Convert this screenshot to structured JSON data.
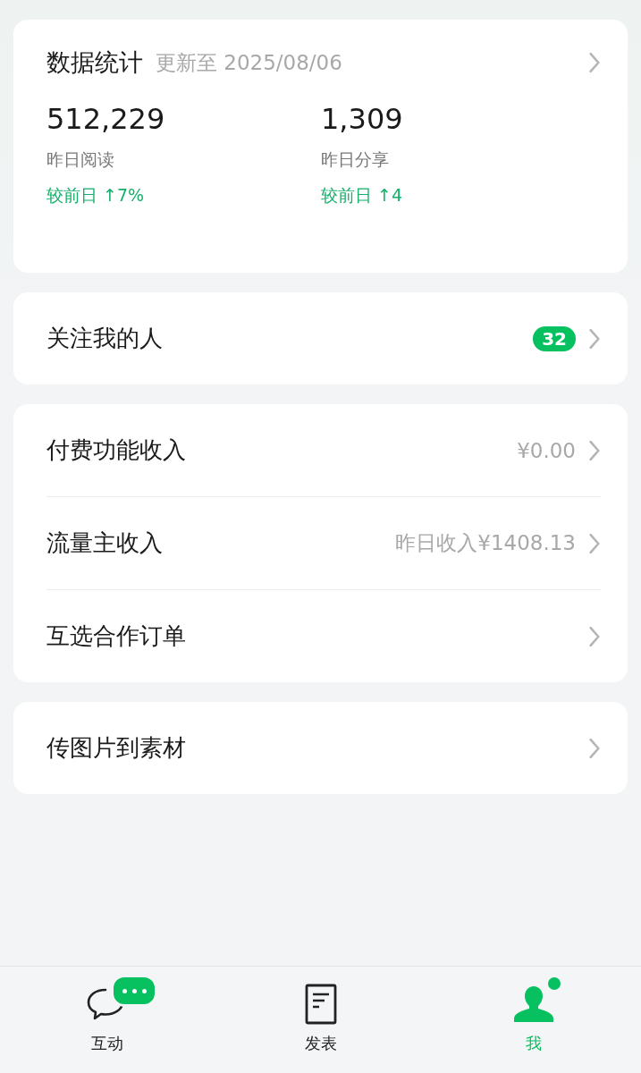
{
  "stats": {
    "title": "数据统计",
    "updated": "更新至 2025/08/06",
    "metrics": [
      {
        "value": "512,229",
        "label": "昨日阅读",
        "change": "较前日 ↑7%"
      },
      {
        "value": "1,309",
        "label": "昨日分享",
        "change": "较前日 ↑4"
      }
    ]
  },
  "groups": [
    [
      {
        "label": "关注我的人",
        "badge": "32"
      }
    ],
    [
      {
        "label": "付费功能收入",
        "value": "¥0.00"
      },
      {
        "label": "流量主收入",
        "value": "昨日收入¥1408.13"
      },
      {
        "label": "互选合作订单"
      }
    ],
    [
      {
        "label": "传图片到素材"
      }
    ]
  ],
  "tabs": [
    {
      "label": "互动",
      "kind": "chat",
      "selected": false,
      "bubble": true,
      "dot": false
    },
    {
      "label": "发表",
      "kind": "doc",
      "selected": false,
      "bubble": false,
      "dot": false
    },
    {
      "label": "我",
      "kind": "person",
      "selected": true,
      "bubble": false,
      "dot": true
    }
  ]
}
